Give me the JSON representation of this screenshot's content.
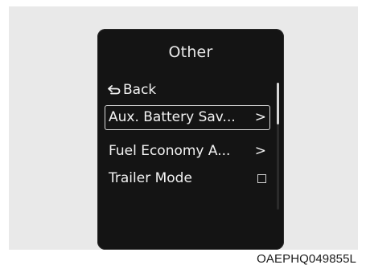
{
  "screen": {
    "title": "Other",
    "back_label": "Back",
    "items": [
      {
        "label": "Aux. Battery Sav...",
        "indicator": "chevron",
        "indicator_glyph": ">",
        "selected": true
      },
      {
        "label": "Fuel Economy A...",
        "indicator": "chevron",
        "indicator_glyph": ">",
        "selected": false
      },
      {
        "label": "Trailer Mode",
        "indicator": "checkbox",
        "checked": false,
        "selected": false
      }
    ],
    "scroll": {
      "position_fraction": 0.0,
      "visible_fraction": 0.33
    }
  },
  "caption": "OAEPHQ049855L",
  "icons": {
    "back": "back-arrow-icon"
  },
  "colors": {
    "screen_bg": "#141414",
    "text": "#f2f2f2",
    "panel_bg": "#e9e9e9"
  }
}
